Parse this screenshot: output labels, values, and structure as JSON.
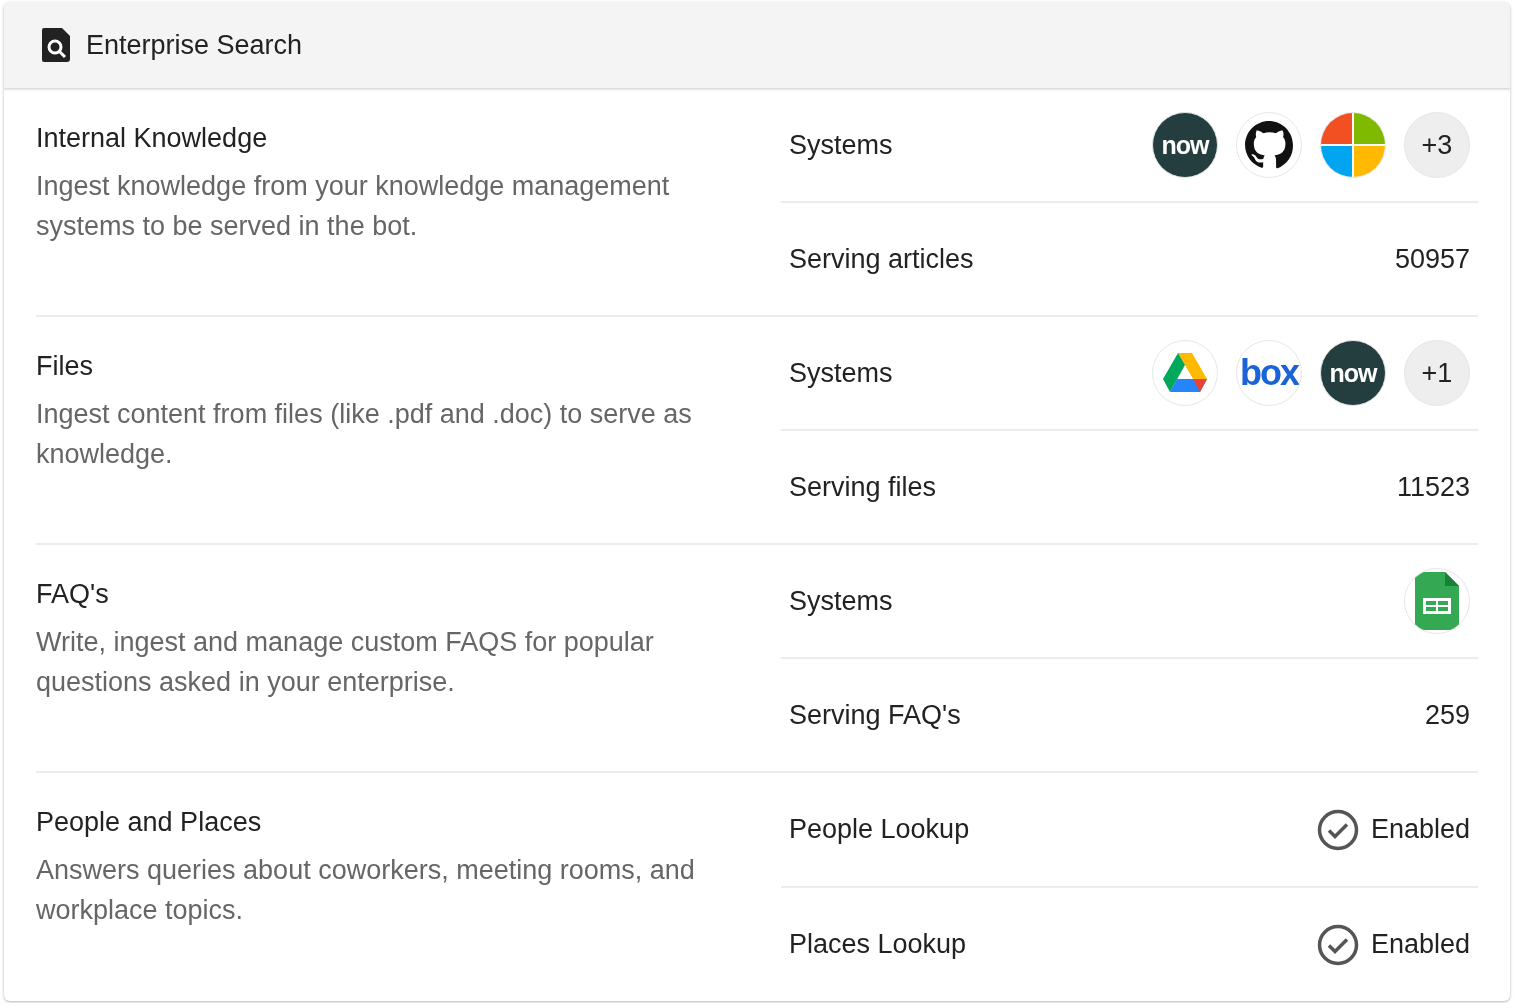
{
  "header": {
    "title": "Enterprise Search"
  },
  "sections": [
    {
      "title": "Internal Knowledge",
      "description": "Ingest knowledge from your knowledge management systems to be served in the bot.",
      "rows": [
        {
          "kind": "systems",
          "label": "Systems",
          "logos": [
            {
              "kind": "now",
              "text": "now"
            },
            {
              "kind": "github"
            },
            {
              "kind": "windows"
            },
            {
              "kind": "more",
              "text": "+3"
            }
          ]
        },
        {
          "kind": "count",
          "label": "Serving articles",
          "value": "50957"
        }
      ]
    },
    {
      "title": "Files",
      "description": "Ingest content from files (like .pdf and .doc) to serve as knowledge.",
      "rows": [
        {
          "kind": "systems",
          "label": "Systems",
          "logos": [
            {
              "kind": "drive"
            },
            {
              "kind": "box",
              "text": "box"
            },
            {
              "kind": "now",
              "text": "now"
            },
            {
              "kind": "more",
              "text": "+1"
            }
          ]
        },
        {
          "kind": "count",
          "label": "Serving files",
          "value": "11523"
        }
      ]
    },
    {
      "title": "FAQ's",
      "description": "Write, ingest and manage custom FAQS for popular questions asked in your enterprise.",
      "rows": [
        {
          "kind": "systems",
          "label": "Systems",
          "logos": [
            {
              "kind": "sheets"
            }
          ]
        },
        {
          "kind": "count",
          "label": "Serving FAQ's",
          "value": "259"
        }
      ]
    },
    {
      "title": "People and Places",
      "description": "Answers queries about coworkers, meeting rooms, and workplace topics.",
      "rows": [
        {
          "kind": "status",
          "label": "People Lookup",
          "value": "Enabled"
        },
        {
          "kind": "status",
          "label": "Places Lookup",
          "value": "Enabled"
        }
      ]
    }
  ]
}
